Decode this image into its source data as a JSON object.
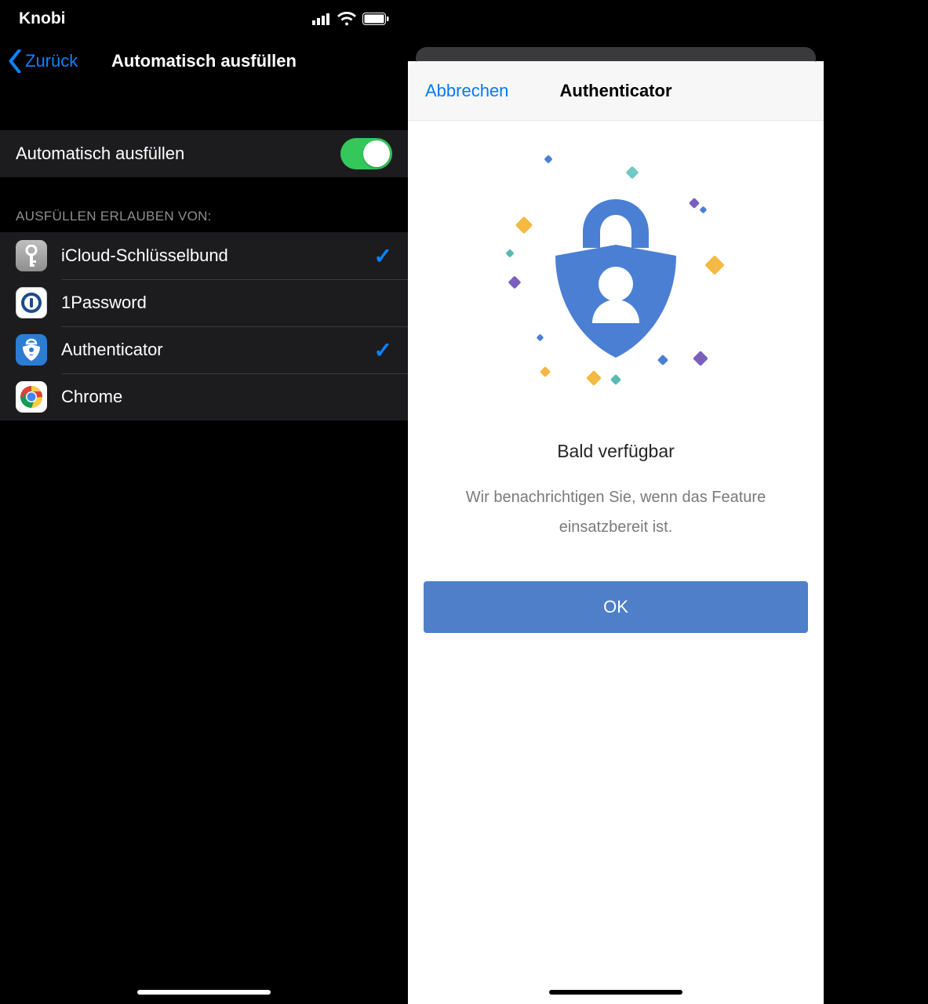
{
  "status": {
    "carrier": "Knobi"
  },
  "left": {
    "back": "Zurück",
    "title": "Automatisch ausfüllen",
    "toggle_label": "Automatisch ausfüllen",
    "section_header": "AUSFÜLLEN ERLAUBEN VON:",
    "providers": [
      {
        "label": "iCloud-Schlüsselbund",
        "checked": true
      },
      {
        "label": "1Password",
        "checked": false
      },
      {
        "label": "Authenticator",
        "checked": true
      },
      {
        "label": "Chrome",
        "checked": false
      }
    ]
  },
  "right": {
    "cancel": "Abbrechen",
    "title": "Authenticator",
    "headline": "Bald verfügbar",
    "subtext": "Wir benachrichtigen Sie, wenn das Feature einsatzbereit ist.",
    "ok": "OK"
  },
  "colors": {
    "accent_blue": "#0a84ff",
    "system_blue": "#007aff",
    "button_blue": "#4f7fc9",
    "switch_green": "#34c759"
  }
}
